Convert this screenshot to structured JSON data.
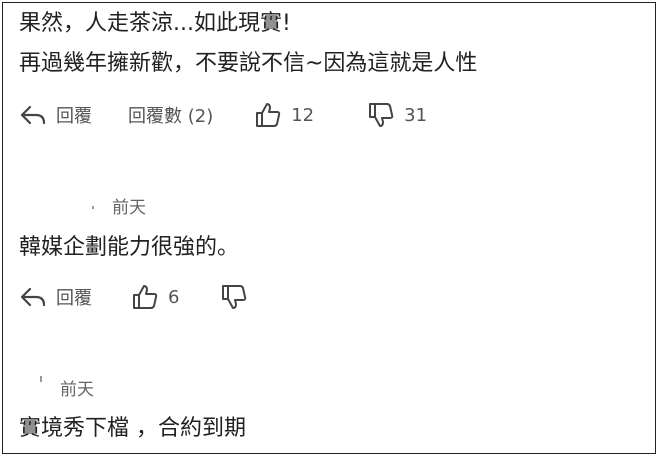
{
  "comments": [
    {
      "lines": [
        "果然，人走茶涼...如此現實!",
        "再過幾年擁新歡，不要說不信~因為這就是人性"
      ],
      "reply_label": "回覆",
      "reply_count_label": "回覆數 (2)",
      "likes": "12",
      "dislikes": "31"
    },
    {
      "time": "前天",
      "text": "韓媒企劃能力很強的。",
      "reply_label": "回覆",
      "likes": "6"
    },
    {
      "time": "前天",
      "text": "實境秀下檔 ，合約到期"
    }
  ],
  "icons": [
    "reply-icon",
    "thumbs-up-icon",
    "thumbs-down-icon"
  ]
}
